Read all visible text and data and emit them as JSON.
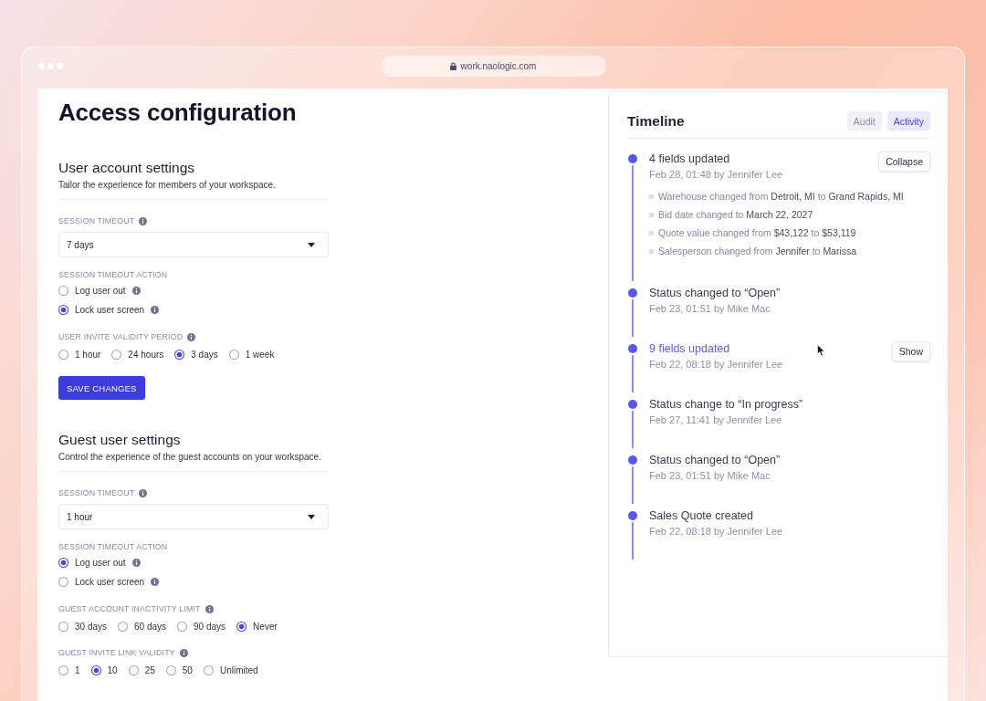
{
  "browser": {
    "url": "work.naologic.com"
  },
  "page": {
    "title": "Access configuration"
  },
  "sections": [
    {
      "heading": "User account settings",
      "description": "Tailor the experience for members of your workspace.",
      "fields": [
        {
          "kind": "select",
          "label": "SESSION TIMEOUT",
          "info": true,
          "value": "7 days"
        },
        {
          "kind": "radio-stack",
          "label": "SESSION TIMEOUT ACTION",
          "info": false,
          "options": [
            {
              "label": "Log user out",
              "info": true,
              "selected": false
            },
            {
              "label": "Lock user screen",
              "info": true,
              "selected": true
            }
          ]
        },
        {
          "kind": "radio-row",
          "label": "USER INVITE VALIDITY PERIOD",
          "info": true,
          "options": [
            {
              "label": "1 hour",
              "info": false,
              "selected": false
            },
            {
              "label": "24 hours",
              "info": false,
              "selected": false
            },
            {
              "label": "3 days",
              "info": false,
              "selected": true
            },
            {
              "label": "1 week",
              "info": false,
              "selected": false
            }
          ]
        }
      ],
      "button": "SAVE CHANGES"
    },
    {
      "heading": "Guest user settings",
      "description": "Control the experience of the guest accounts on your workspace.",
      "fields": [
        {
          "kind": "select",
          "label": "SESSION TIMEOUT",
          "info": true,
          "value": "1 hour"
        },
        {
          "kind": "radio-stack",
          "label": "SESSION TIMEOUT ACTION",
          "info": false,
          "options": [
            {
              "label": "Log user out",
              "info": true,
              "selected": true
            },
            {
              "label": "Lock user screen",
              "info": true,
              "selected": false
            }
          ]
        },
        {
          "kind": "radio-row",
          "label": "GUEST ACCOUNT INACTIVITY LIMIT",
          "info": true,
          "options": [
            {
              "label": "30 days",
              "info": false,
              "selected": false
            },
            {
              "label": "60 days",
              "info": false,
              "selected": false
            },
            {
              "label": "90 days",
              "info": false,
              "selected": false
            },
            {
              "label": "Never",
              "info": false,
              "selected": true
            }
          ]
        },
        {
          "kind": "radio-row",
          "label": "GUEST INVITE LINK VALIDITY",
          "info": true,
          "options": [
            {
              "label": "1",
              "info": false,
              "selected": false
            },
            {
              "label": "10",
              "info": false,
              "selected": true
            },
            {
              "label": "25",
              "info": false,
              "selected": false
            },
            {
              "label": "50",
              "info": false,
              "selected": false
            },
            {
              "label": "Unlimited",
              "info": false,
              "selected": false
            }
          ]
        }
      ]
    }
  ],
  "timeline": {
    "title": "Timeline",
    "tabs": [
      {
        "label": "Audit",
        "selected": false
      },
      {
        "label": "Activity",
        "selected": true
      }
    ],
    "events": [
      {
        "title": "4 fields updated",
        "meta": "Feb 28, 01:48 by Jennifer Lee",
        "highlighted": false,
        "button": "Collapse",
        "details": [
          "Warehouse changed from **Detroit, MI** to **Grand Rapids, MI**",
          "Bid date changed to **March 22, 2027**",
          "Quote value changed from **$43,122** to **$53,119**",
          "Salesperson changed from **Jennifer** to **Marissa**"
        ]
      },
      {
        "title": "Status changed to “Open”",
        "meta": "Feb 23, 01:51 by Mike Mac",
        "highlighted": false
      },
      {
        "title": "9 fields updated",
        "meta": "Feb 22, 08:18 by Jennifer Lee",
        "highlighted": true,
        "button": "Show"
      },
      {
        "title": "Status change to “In progress”",
        "meta": "Feb 27, 11:41 by Jennifer Lee",
        "highlighted": false
      },
      {
        "title": "Status changed to “Open”",
        "meta": "Feb 23, 01:51 by Mike Mac",
        "highlighted": false
      },
      {
        "title": "Sales Quote created",
        "meta": "Feb 22, 08:18 by Jennifer Lee",
        "highlighted": false
      }
    ]
  }
}
